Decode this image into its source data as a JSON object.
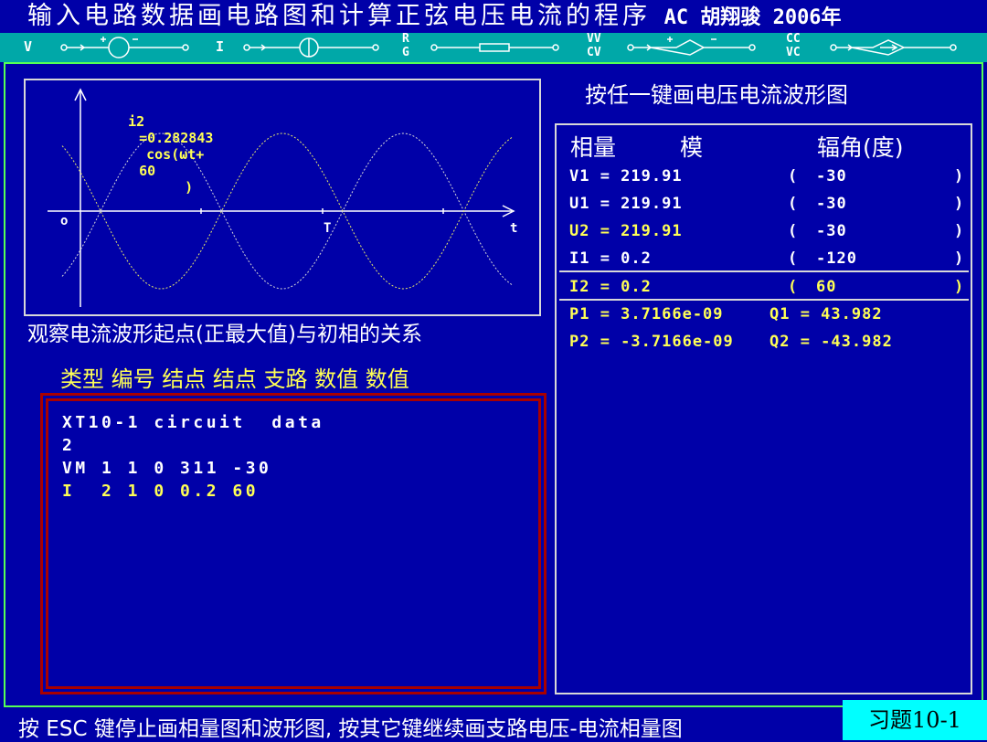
{
  "header": {
    "title": "输入电路数据画电路图和计算正弦电压电流的程序",
    "author": "AC 胡翔骏 2006年"
  },
  "component_bar": {
    "labels": [
      "V",
      "I",
      "R",
      "G",
      "VV",
      "CV",
      "CC",
      "VC"
    ]
  },
  "prompt": "按任一键画电压电流波形图",
  "waveform": {
    "equation": {
      "var": "i2",
      "amp": "=0.282843",
      "func": "cos(",
      "omega": "ω",
      "rest": "t+",
      "phase": "60",
      "close": ")"
    },
    "origin": "o",
    "period": "T",
    "axis": "t",
    "caption": "观察电流波形起点(正最大值)与初相的关系"
  },
  "columns_label": "类型 编号 结点 结点 支路 数值 数值",
  "data_lines": [
    "XT10-1 circuit  data",
    "2",
    "VM 1 1 0 311 -30",
    "I  2 1 0 0.2 60"
  ],
  "phasor_table": {
    "header": {
      "phasor": "相量",
      "magnitude": "模",
      "angle": "辐角(度)"
    },
    "rows": [
      {
        "name": "V1 = 219.91",
        "open": "(",
        "angle": "-30",
        "close": ")"
      },
      {
        "name": "U1 = 219.91",
        "open": "(",
        "angle": "-30",
        "close": ")"
      },
      {
        "name": "U2 = 219.91",
        "open": "(",
        "angle": "-30",
        "close": ")"
      },
      {
        "name": "I1 = 0.2",
        "open": "(",
        "angle": "-120",
        "close": ")"
      },
      {
        "name": "I2 = 0.2",
        "open": "(",
        "angle": "60",
        "close": ")"
      }
    ],
    "power": [
      {
        "p": "P1 = 3.7166e-09",
        "q": "Q1 = 43.982"
      },
      {
        "p": "P2 = -3.7166e-09",
        "q": "Q2 = -43.982"
      }
    ]
  },
  "status_bar": {
    "text": "按 ESC 键停止画相量图和波形图, 按其它键继续画支路电压-电流相量图"
  },
  "exercise_button": {
    "label": "习题10-1"
  },
  "colors": {
    "background": "#0000a8",
    "bar": "#00a8a8",
    "highlight": "#ffff55",
    "button": "#00ffff"
  }
}
